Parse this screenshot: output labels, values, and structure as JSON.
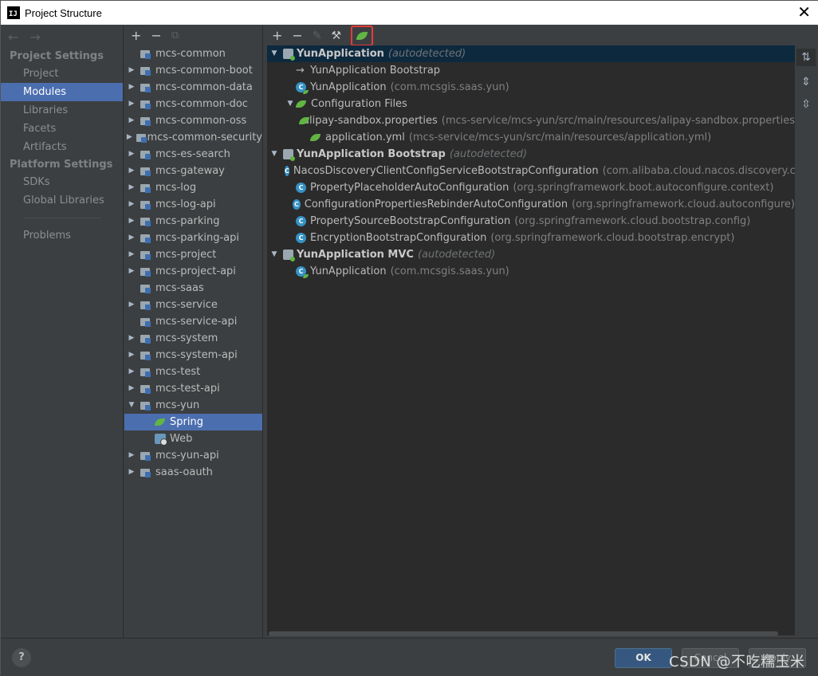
{
  "window": {
    "title": "Project Structure",
    "app_icon_text": "IJ"
  },
  "nav": {
    "back_arrow": "←",
    "forward_arrow": "→",
    "section_project": "Project Settings",
    "project_items": [
      "Project",
      "Modules",
      "Libraries",
      "Facets",
      "Artifacts"
    ],
    "section_platform": "Platform Settings",
    "platform_items": [
      "SDKs",
      "Global Libraries"
    ],
    "problems": "Problems",
    "selected": "Modules"
  },
  "modules": {
    "toolbar": {
      "add": "+",
      "remove": "−",
      "copy": "⧉"
    },
    "rows": [
      {
        "label": "mcs-common",
        "expandable": false
      },
      {
        "label": "mcs-common-boot",
        "expandable": true
      },
      {
        "label": "mcs-common-data",
        "expandable": true
      },
      {
        "label": "mcs-common-doc",
        "expandable": true
      },
      {
        "label": "mcs-common-oss",
        "expandable": true
      },
      {
        "label": "mcs-common-security",
        "expandable": true
      },
      {
        "label": "mcs-es-search",
        "expandable": true
      },
      {
        "label": "mcs-gateway",
        "expandable": true
      },
      {
        "label": "mcs-log",
        "expandable": true
      },
      {
        "label": "mcs-log-api",
        "expandable": true
      },
      {
        "label": "mcs-parking",
        "expandable": true
      },
      {
        "label": "mcs-parking-api",
        "expandable": true
      },
      {
        "label": "mcs-project",
        "expandable": true
      },
      {
        "label": "mcs-project-api",
        "expandable": true
      },
      {
        "label": "mcs-saas",
        "expandable": false
      },
      {
        "label": "mcs-service",
        "expandable": true
      },
      {
        "label": "mcs-service-api",
        "expandable": false
      },
      {
        "label": "mcs-system",
        "expandable": true
      },
      {
        "label": "mcs-system-api",
        "expandable": true
      },
      {
        "label": "mcs-test",
        "expandable": true
      },
      {
        "label": "mcs-test-api",
        "expandable": true
      },
      {
        "label": "mcs-yun",
        "expanded": true
      },
      {
        "label": "Spring",
        "child": true,
        "icon": "spring-icon",
        "selected": true
      },
      {
        "label": "Web",
        "child": true,
        "icon": "web-icon"
      },
      {
        "label": "mcs-yun-api",
        "expandable": true
      },
      {
        "label": "saas-oauth",
        "expandable": true
      }
    ]
  },
  "spring_panel": {
    "toolbar": {
      "add": "+",
      "remove": "−",
      "edit": "✎",
      "wrench": "🔧",
      "spring_facet": "spring-facet-icon"
    },
    "tree": [
      {
        "level": 0,
        "icon": "boot-icon",
        "name": "YunApplication",
        "suffix": "(autodetected)",
        "expanded": true,
        "highlight": true
      },
      {
        "level": 1,
        "icon": "arrow-icon",
        "name": "YunApplication Bootstrap",
        "detail": ""
      },
      {
        "level": 1,
        "icon": "class-spring-icon",
        "name": "YunApplication",
        "detail": "(com.mcsgis.saas.yun)"
      },
      {
        "level": 1,
        "icon": "spring-icon",
        "name": "Configuration Files",
        "detail": "",
        "expanded": true
      },
      {
        "level": 2,
        "icon": "spring-icon",
        "name": "alipay-sandbox.properties",
        "detail": "(mcs-service/mcs-yun/src/main/resources/alipay-sandbox.properties)"
      },
      {
        "level": 2,
        "icon": "spring-icon",
        "name": "application.yml",
        "detail": "(mcs-service/mcs-yun/src/main/resources/application.yml)"
      },
      {
        "level": 0,
        "icon": "boot-icon",
        "name": "YunApplication Bootstrap",
        "suffix": "(autodetected)",
        "expanded": true
      },
      {
        "level": 1,
        "icon": "class-icon",
        "name": "NacosDiscoveryClientConfigServiceBootstrapConfiguration",
        "detail": "(com.alibaba.cloud.nacos.discovery.configclie"
      },
      {
        "level": 1,
        "icon": "class-icon",
        "name": "PropertyPlaceholderAutoConfiguration",
        "detail": "(org.springframework.boot.autoconfigure.context)"
      },
      {
        "level": 1,
        "icon": "class-icon",
        "name": "ConfigurationPropertiesRebinderAutoConfiguration",
        "detail": "(org.springframework.cloud.autoconfigure)"
      },
      {
        "level": 1,
        "icon": "class-icon",
        "name": "PropertySourceBootstrapConfiguration",
        "detail": "(org.springframework.cloud.bootstrap.config)"
      },
      {
        "level": 1,
        "icon": "class-icon",
        "name": "EncryptionBootstrapConfiguration",
        "detail": "(org.springframework.cloud.bootstrap.encrypt)"
      },
      {
        "level": 0,
        "icon": "boot-icon",
        "name": "YunApplication MVC",
        "suffix": "(autodetected)",
        "expanded": true
      },
      {
        "level": 1,
        "icon": "class-spring-icon",
        "name": "YunApplication",
        "detail": "(com.mcsgis.saas.yun)"
      }
    ],
    "side_tools": [
      "sort-icon",
      "expand-all-icon",
      "collapse-all-icon"
    ]
  },
  "footer": {
    "help": "?",
    "ok": "OK",
    "cancel": "Cancel",
    "apply": "Apply",
    "watermark": "CSDN @不吃糯玉米"
  },
  "colors": {
    "background": "#3c3f41",
    "tree_bg": "#2b2b2b",
    "selection": "#4b6eaf",
    "highlight_row": "#0d293e",
    "spring_green": "#62b543",
    "highlight_box": "#e53b3b",
    "ok_button": "#365880"
  }
}
